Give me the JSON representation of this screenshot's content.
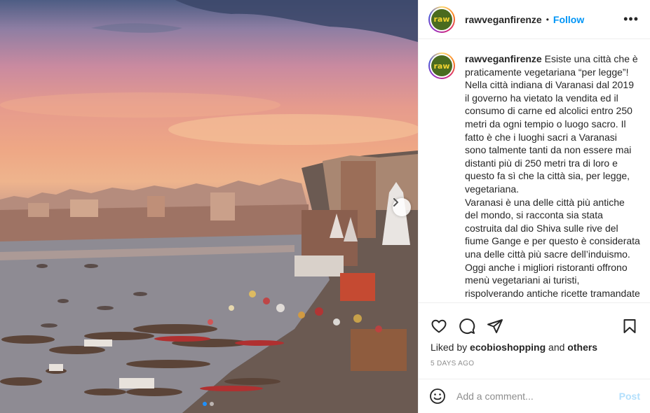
{
  "post": {
    "username": "rawveganfirenze",
    "avatar_text": "raw",
    "follow_label": "Follow",
    "separator": "•",
    "more_label": "•••",
    "caption_text": "Esiste una città che è praticamente vegetariana “per legge”!\nNella città indiana di Varanasi dal 2019 il governo ha vietato la vendita ed il consumo di carne ed alcolici entro 250 metri da ogni tempio o luogo sacro. Il fatto è che i luoghi sacri a Varanasi sono talmente tanti da non essere mai distanti più di 250 metri tra di loro e questo fa sì che la città sia, per legge, vegetariana.\nVaranasi è una delle città più antiche del mondo, si racconta sia stata costruita dal dio Shiva sulle rive del fiume Gange e per questo è considerata una delle città più sacre dell’induismo.\nOggi anche i migliori ristoranti offrono menù vegetariani ai turisti, rispolverando antiche ricette tramandate nelle famiglie di Varanasi di generazione in generazione.",
    "liked_prefix": "Liked by ",
    "liked_user": "ecobioshopping",
    "liked_and": " and ",
    "liked_others": "others",
    "date": "5 DAYS AGO",
    "comment_placeholder": "Add a comment...",
    "post_label": "Post"
  },
  "icons": {
    "like": "heart-icon",
    "comment": "comment-icon",
    "share": "share-icon",
    "save": "bookmark-icon",
    "emoji": "emoji-icon",
    "next": "chevron-right-icon"
  },
  "colors": {
    "accent": "#0095f6",
    "post_disabled": "#b2dffc",
    "meta": "#8e8e8e"
  },
  "carousel": {
    "total": 2,
    "current": 1
  }
}
